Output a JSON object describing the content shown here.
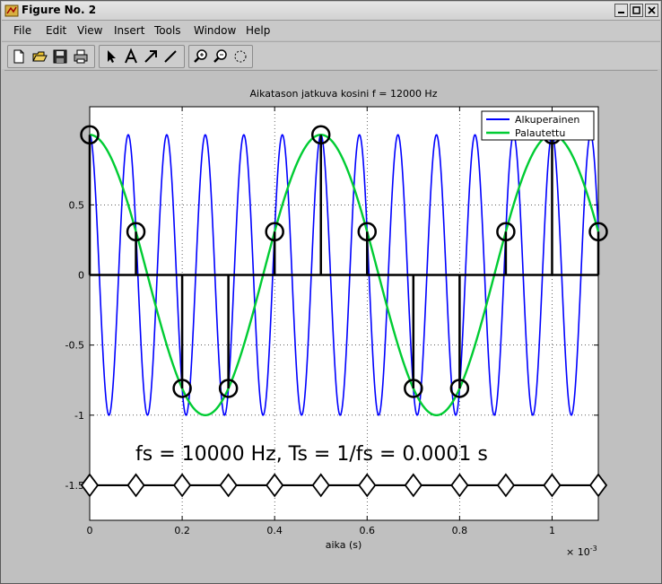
{
  "window": {
    "title": "Figure No. 2"
  },
  "menu": [
    "File",
    "Edit",
    "View",
    "Insert",
    "Tools",
    "Window",
    "Help"
  ],
  "toolbar": {
    "buttons": [
      "new-file-icon",
      "open-folder-icon",
      "save-icon",
      "print-icon",
      "arrow-select-icon",
      "text-insert-icon",
      "arrow-insert-icon",
      "line-insert-icon",
      "zoom-in-icon",
      "zoom-out-icon",
      "rotate-icon"
    ]
  },
  "chart_data": {
    "type": "line",
    "title": "Aikatason jatkuva kosini f = 12000 Hz",
    "xlabel": "aika (s)",
    "ylabel": "",
    "x_exponent_label": "× 10",
    "x_exponent": "-3",
    "xlim": [
      0,
      0.0011
    ],
    "ylim": [
      -1.75,
      1.2
    ],
    "xticks": [
      0,
      0.0002,
      0.0004,
      0.0006,
      0.0008,
      0.001
    ],
    "xtick_labels": [
      "0",
      "0.2",
      "0.4",
      "0.6",
      "0.8",
      "1"
    ],
    "yticks": [
      -1.5,
      -1,
      -0.5,
      0,
      0.5
    ],
    "ytick_labels": [
      "-1.5",
      "-1",
      "-0.5",
      "0",
      "0.5"
    ],
    "grid": true,
    "legend": {
      "position": "top-right",
      "entries": [
        {
          "name": "Alkuperainen",
          "color": "#0000ff"
        },
        {
          "name": "Palautettu",
          "color": "#00cc33"
        }
      ]
    },
    "series": [
      {
        "name": "Alkuperainen",
        "kind": "line",
        "color": "#0000ff",
        "frequency_hz": 12000
      },
      {
        "name": "Palautettu",
        "kind": "line",
        "color": "#00cc33",
        "frequency_hz": 2000
      }
    ],
    "samples": {
      "x": [
        0,
        0.0001,
        0.0002,
        0.0003,
        0.0004,
        0.0005,
        0.0006,
        0.0007,
        0.0008,
        0.0009,
        0.001,
        0.0011
      ],
      "y": [
        1,
        0.309,
        -0.809,
        -0.809,
        0.309,
        1,
        0.309,
        -0.809,
        -0.809,
        0.309,
        1,
        0.309
      ]
    },
    "sample_ticks": {
      "x": [
        0,
        0.0001,
        0.0002,
        0.0003,
        0.0004,
        0.0005,
        0.0006,
        0.0007,
        0.0008,
        0.0009,
        0.001,
        0.0011
      ],
      "y": -1.5
    },
    "annotation": "fs = 10000 Hz, Ts = 1/fs = 0.0001 s",
    "colors": {
      "stem": "#000000",
      "markers": "#000000"
    }
  }
}
